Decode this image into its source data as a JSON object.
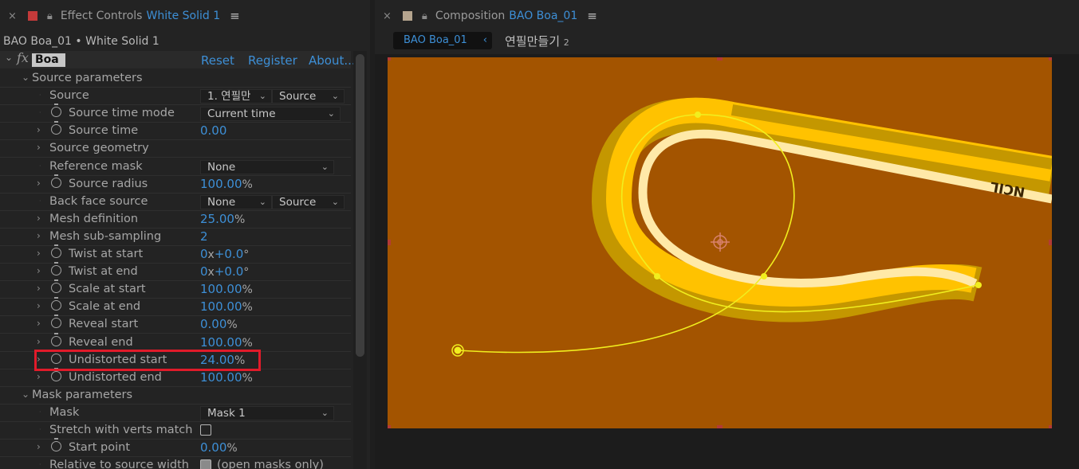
{
  "effect_panel": {
    "title": "Effect Controls",
    "target": "White Solid 1",
    "layer_path": "BAO Boa_01 • White Solid 1",
    "effect": {
      "fx_label": "fx",
      "name": "Boa",
      "reset": "Reset",
      "register": "Register",
      "about": "About..."
    },
    "rows": [
      {
        "label": "Source parameters"
      },
      {
        "label": "Source",
        "value": "1. 연필만",
        "value2": "Source"
      },
      {
        "label": "Source time mode",
        "value": "Current time"
      },
      {
        "label": "Source time",
        "value": "0.00",
        "unit": ""
      },
      {
        "label": "Source geometry"
      },
      {
        "label": "Reference mask",
        "value": "None"
      },
      {
        "label": "Source radius",
        "value": "100.00",
        "unit": "%"
      },
      {
        "label": "Back face source",
        "value": "None",
        "value2": "Source"
      },
      {
        "label": "Mesh definition",
        "value": "25.00",
        "unit": "%"
      },
      {
        "label": "Mesh sub-sampling",
        "value": "2",
        "unit": ""
      },
      {
        "label": "Twist at start",
        "value": "0",
        "unit": "x",
        "value2": "+0.0",
        "unit2": "°"
      },
      {
        "label": "Twist at end",
        "value": "0",
        "unit": "x",
        "value2": "+0.0",
        "unit2": "°"
      },
      {
        "label": "Scale at start",
        "value": "100.00",
        "unit": "%"
      },
      {
        "label": "Scale at end",
        "value": "100.00",
        "unit": "%"
      },
      {
        "label": "Reveal start",
        "value": "0.00",
        "unit": "%"
      },
      {
        "label": "Reveal end",
        "value": "100.00",
        "unit": "%"
      },
      {
        "label": "Undistorted start",
        "value": "24.00",
        "unit": "%"
      },
      {
        "label": "Undistorted end",
        "value": "100.00",
        "unit": "%"
      },
      {
        "label": "Mask parameters"
      },
      {
        "label": "Mask",
        "value": "Mask 1"
      },
      {
        "label": "Stretch with verts match",
        "checked": false
      },
      {
        "label": "Start point",
        "value": "0.00",
        "unit": "%"
      },
      {
        "label": "Relative to source width",
        "checked": true,
        "note": "(open masks only)"
      }
    ]
  },
  "comp_panel": {
    "title": "Composition",
    "name": "BAO Boa_01",
    "crumb_active": "BAO Boa_01",
    "crumb_next": "연필만들기",
    "crumb_next_suffix": "2",
    "comp_text": "NCIL",
    "colors": {
      "background": "#a35400",
      "tube_outer": "#c49700",
      "tube_mid": "#ffc200",
      "tube_inner": "#ffe9a8",
      "path": "#f1ee1e"
    }
  }
}
